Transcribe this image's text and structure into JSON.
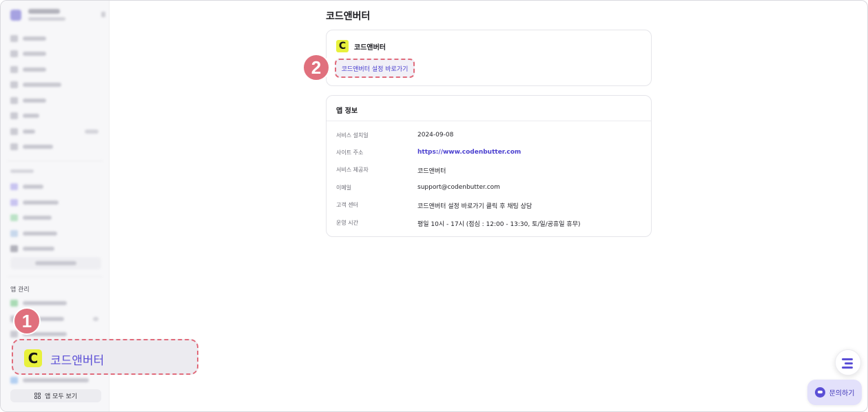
{
  "sidebar": {
    "app_section_heading": "앱 관리",
    "highlighted_item": {
      "label": "코드앤버터",
      "logo_letter": "C"
    },
    "all_apps_button": "앱 모두 보기"
  },
  "markers": {
    "first": "1",
    "second": "2"
  },
  "main": {
    "page_title": "코드앤버터",
    "app_card": {
      "logo_letter": "C",
      "name": "코드앤버터",
      "settings_button": "코드앤버터 설정 바로가기"
    },
    "info_card": {
      "title": "앱 정보",
      "rows": [
        {
          "label": "서비스 설치일",
          "value": "2024-09-08"
        },
        {
          "label": "사이트 주소",
          "value": "https://www.codenbutter.com"
        },
        {
          "label": "서비스 제공자",
          "value": "코드앤버터"
        },
        {
          "label": "이메일",
          "value": "support@codenbutter.com"
        },
        {
          "label": "고객 센터",
          "value": "코드앤버터 설정 바로가기 클릭 후 채팅 상담"
        },
        {
          "label": "운영 시간",
          "value": "평일 10시 - 17시 (점심 : 12:00 - 13:30, 토/일/공휴일 휴무)"
        }
      ]
    }
  },
  "floating": {
    "chat_button": "문의하기",
    "menu_icon": "stacked-lines-icon",
    "chat_icon": "chat-bubble-icon"
  },
  "colors": {
    "accent": "#5b4fd6",
    "highlight": "#e06b7b",
    "logo_bg": "#e8f13c"
  }
}
